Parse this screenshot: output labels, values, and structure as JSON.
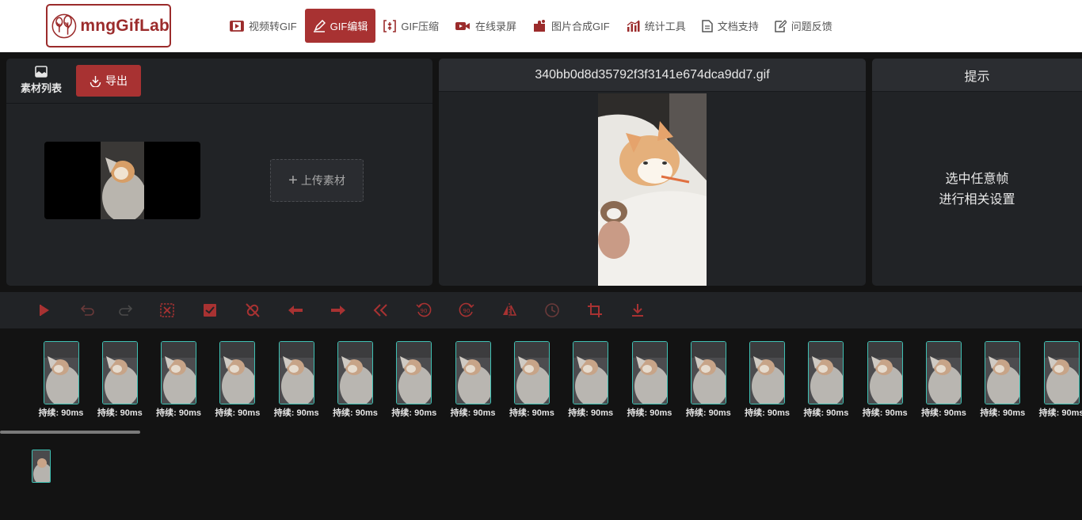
{
  "header": {
    "logo_text": "mngGifLab",
    "nav": [
      {
        "label": "视频转GIF",
        "icon": "film-icon"
      },
      {
        "label": "GIF编辑",
        "icon": "pen-icon",
        "active": true
      },
      {
        "label": "GIF压缩",
        "icon": "compress-icon"
      },
      {
        "label": "在线录屏",
        "icon": "video-camera-icon"
      },
      {
        "label": "图片合成GIF",
        "icon": "puzzle-icon"
      },
      {
        "label": "统计工具",
        "icon": "bar-chart-icon"
      },
      {
        "label": "文档支持",
        "icon": "document-icon"
      },
      {
        "label": "问题反馈",
        "icon": "edit-note-icon"
      }
    ]
  },
  "materials": {
    "list_label": "素材列表",
    "export_label": "导出",
    "upload_label": "上传素材"
  },
  "preview": {
    "filename": "340bb0d8d35792f3f3141e674dca9dd7.gif"
  },
  "tips": {
    "title": "提示",
    "line1": "选中任意帧",
    "line2": "进行相关设置"
  },
  "toolbar": {
    "color": "#a83232",
    "tools": [
      "play-icon",
      "undo-icon",
      "redo-icon",
      "delete-selection-icon",
      "select-all-icon",
      "unlink-icon",
      "arrow-left-icon",
      "arrow-right-icon",
      "double-chevron-left-icon",
      "rotate-left-90-icon",
      "rotate-right-90-icon",
      "flip-horizontal-icon",
      "clock-icon",
      "crop-icon",
      "download-icon"
    ]
  },
  "frames": {
    "duration_label": "持续: 90ms",
    "count_visible": 18
  },
  "colors": {
    "accent": "#a83232",
    "frame_border": "#3fc1b4",
    "panel": "#212326",
    "background": "#131313"
  }
}
